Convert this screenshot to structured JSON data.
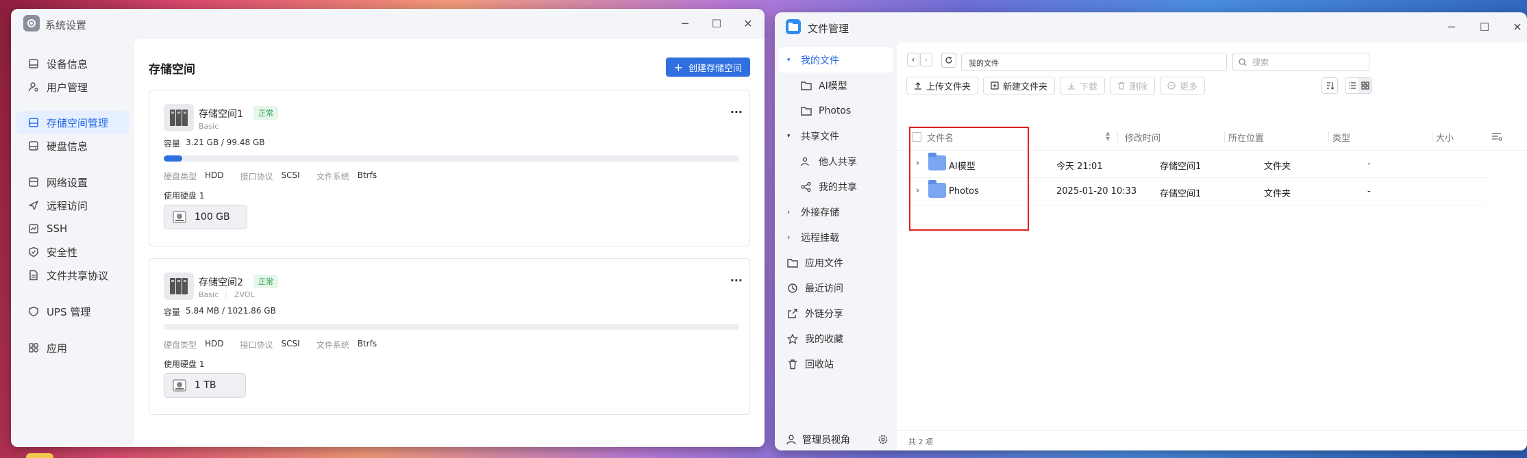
{
  "settings": {
    "title": "系统设置",
    "window_controls": {
      "min": "─",
      "max": "☐",
      "close": "✕"
    },
    "nav": [
      {
        "label": "设备信息",
        "icon": "device-icon"
      },
      {
        "label": "用户管理",
        "icon": "user-icon"
      },
      {
        "label": "存储空间管理",
        "icon": "storage-icon",
        "active": true
      },
      {
        "label": "硬盘信息",
        "icon": "disk-icon"
      },
      {
        "label": "网络设置",
        "icon": "network-icon"
      },
      {
        "label": "远程访问",
        "icon": "remote-icon"
      },
      {
        "label": "SSH",
        "icon": "ssh-icon"
      },
      {
        "label": "安全性",
        "icon": "shield-icon"
      },
      {
        "label": "文件共享协议",
        "icon": "file-share-icon"
      },
      {
        "label": "UPS 管理",
        "icon": "ups-icon"
      },
      {
        "label": "应用",
        "icon": "apps-icon"
      }
    ],
    "page_title": "存储空间",
    "create_button": "创建存储空间",
    "create_icon": "+",
    "more_icon": "···",
    "pools": [
      {
        "name": "存储空间1",
        "status": "正常",
        "type": "Basic",
        "extra": "",
        "capacity_label": "容量",
        "used": "3.21 GB",
        "total": "/ 99.48 GB",
        "usage_fraction": 0.032,
        "disk_type_label": "硬盘类型",
        "disk_type": "HDD",
        "iface_label": "接口协议",
        "iface": "SCSI",
        "fs_label": "文件系统",
        "fs": "Btrfs",
        "used_disk_label": "使用硬盘 1",
        "disk_size": "100 GB"
      },
      {
        "name": "存储空间2",
        "status": "正常",
        "type": "Basic",
        "extra": "ZVOL",
        "capacity_label": "容量",
        "used": "5.84 MB",
        "total": "/ 1021.86 GB",
        "usage_fraction": 0.0,
        "disk_type_label": "硬盘类型",
        "disk_type": "HDD",
        "iface_label": "接口协议",
        "iface": "SCSI",
        "fs_label": "文件系统",
        "fs": "Btrfs",
        "used_disk_label": "使用硬盘 1",
        "disk_size": "1 TB"
      }
    ]
  },
  "files": {
    "title": "文件管理",
    "nav": [
      {
        "label": "我的文件",
        "caret": "▾",
        "active": true
      },
      {
        "label": "AI模型",
        "sub": true,
        "icon": "folder-outline-icon"
      },
      {
        "label": "Photos",
        "sub": true,
        "icon": "folder-outline-icon"
      },
      {
        "label": "共享文件",
        "caret": "▾"
      },
      {
        "label": "他人共享",
        "sub": true,
        "icon": "users-icon"
      },
      {
        "label": "我的共享",
        "sub": true,
        "icon": "share-icon"
      },
      {
        "label": "外接存储",
        "caret": "›"
      },
      {
        "label": "远程挂载",
        "caret": "›"
      },
      {
        "label": "应用文件",
        "icon": "app-folder-icon"
      },
      {
        "label": "最近访问",
        "icon": "clock-icon"
      },
      {
        "label": "外链分享",
        "icon": "link-share-icon"
      },
      {
        "label": "我的收藏",
        "icon": "star-icon"
      },
      {
        "label": "回收站",
        "icon": "trash-icon"
      }
    ],
    "admin_view": "管理员视角",
    "path": "我的文件",
    "search_placeholder": "搜索",
    "toolbar": {
      "upload": "上传文件夹",
      "new_folder": "新建文件夹",
      "download": "下载",
      "delete": "删除",
      "more": "更多"
    },
    "columns": {
      "name": "文件名",
      "modified": "修改时间",
      "location": "所在位置",
      "type": "类型",
      "size": "大小"
    },
    "rows": [
      {
        "name": "AI模型",
        "modified": "今天 21:01",
        "location": "存储空间1",
        "type": "文件夹",
        "size": "-"
      },
      {
        "name": "Photos",
        "modified": "2025-01-20 10:33",
        "location": "存储空间1",
        "type": "文件夹",
        "size": "-"
      }
    ],
    "footer": "共 2 项"
  },
  "colors": {
    "accent": "#2f6fe0",
    "ok": "#2e9b4f",
    "highlight_box": "#e02020"
  }
}
